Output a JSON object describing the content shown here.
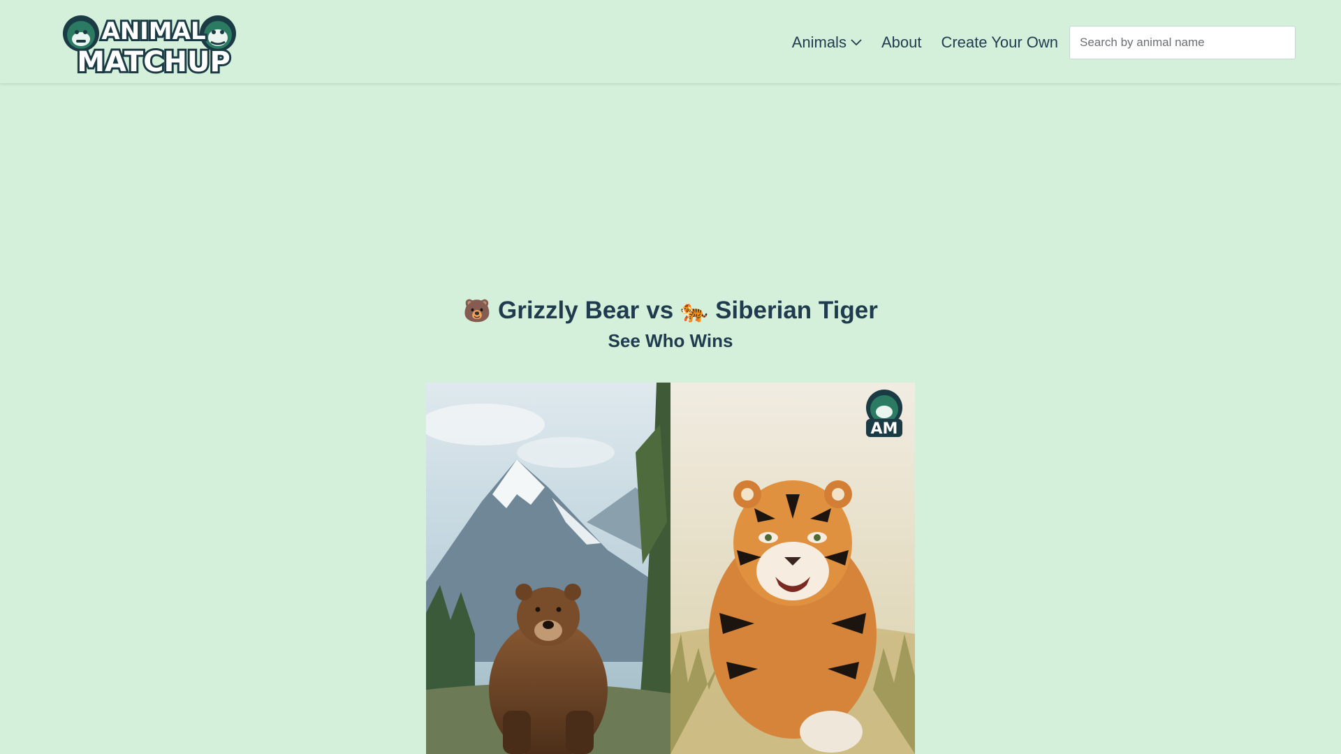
{
  "header": {
    "logo": {
      "line1": "ANIMAL",
      "line2": "MATCHUP",
      "icon": "gorilla-and-bulldog-logo"
    },
    "nav": [
      {
        "label": "Animals",
        "icon": "chevron-down-icon"
      },
      {
        "label": "About"
      },
      {
        "label": "Create Your Own"
      }
    ],
    "search": {
      "placeholder": "Search by animal name",
      "value": ""
    }
  },
  "matchup": {
    "animal1": {
      "name": "Grizzly Bear",
      "emoji": "🐻"
    },
    "vs": "vs",
    "animal2": {
      "name": "Siberian Tiger",
      "emoji": "🐅"
    },
    "subtitle": "See Who Wins"
  },
  "images": {
    "left": {
      "subject": "grizzly bear in mountain landscape"
    },
    "right": {
      "subject": "siberian tiger charging through grass",
      "badge": "AM"
    }
  },
  "colors": {
    "background": "#d4f0da",
    "text": "#1f3b4d",
    "logo_green": "#2b7a62",
    "logo_dark": "#1a3a44"
  }
}
